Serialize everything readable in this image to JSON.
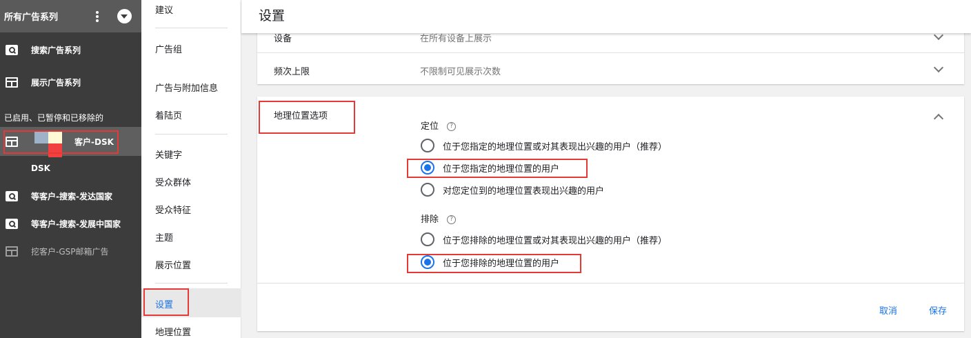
{
  "sidebar": {
    "header_title": "所有广告系列",
    "items": [
      {
        "label": "搜索广告系列",
        "icon": "search-icon"
      },
      {
        "label": "展示广告系列",
        "icon": "display-icon"
      }
    ],
    "section_label": "已启用、已暂停和已移除的",
    "campaigns": [
      {
        "label": "客户-DSK",
        "sub": "DSK",
        "icon": "display-icon",
        "selected": true
      },
      {
        "label": "等客户-搜索-发达国家",
        "icon": "search-icon"
      },
      {
        "label": "等客户-搜索-发展中国家",
        "icon": "search-icon"
      },
      {
        "label": "挖客户-GSP邮箱广告",
        "icon": "display-icon",
        "paused": true
      }
    ]
  },
  "nav": {
    "items": [
      "建议",
      "广告组",
      "广告与附加信息",
      "着陆页",
      "关键字",
      "受众群体",
      "受众特征",
      "主题",
      "展示位置",
      "设置",
      "地理位置"
    ],
    "active": "设置"
  },
  "main": {
    "title": "设置",
    "rows": [
      {
        "label": "设备",
        "value": "在所有设备上展示"
      },
      {
        "label": "频次上限",
        "value": "不限制可见展示次数"
      }
    ],
    "geo": {
      "title": "地理位置选项",
      "targeting_label": "定位",
      "targeting_options": [
        "位于您指定的地理位置或对其表现出兴趣的用户（推荐）",
        "位于您指定的地理位置的用户",
        "对您定位到的地理位置表现出兴趣的用户"
      ],
      "targeting_selected": 1,
      "exclusion_label": "排除",
      "exclusion_options": [
        "位于您排除的地理位置或对其表现出兴趣的用户（推荐）",
        "位于您排除的地理位置的用户"
      ],
      "exclusion_selected": 1,
      "cancel": "取消",
      "save": "保存"
    }
  },
  "colors": {
    "accent": "#1a73e8",
    "highlight": "#e53935",
    "sidebar_bg": "#3c3c3c"
  }
}
